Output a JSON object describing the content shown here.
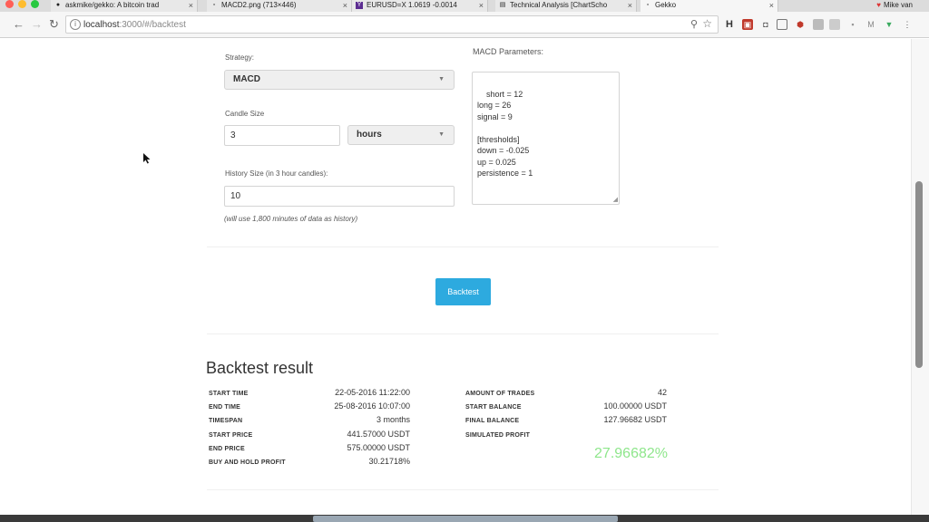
{
  "browser": {
    "tabs": [
      {
        "title": "askmike/gekko: A bitcoin trad",
        "favicon": "github-icon"
      },
      {
        "title": "MACD2.png (713×446)",
        "favicon": "page-icon"
      },
      {
        "title": "EURUSD=X 1.0619 -0.0014",
        "favicon": "yahoo-icon"
      },
      {
        "title": "Technical Analysis [ChartScho",
        "favicon": "chart-icon"
      },
      {
        "title": "Gekko",
        "favicon": "page-icon"
      }
    ],
    "profile_name": "Mike van",
    "url_host": "localhost",
    "url_path": ":3000/#/backtest"
  },
  "form": {
    "strategy_label": "Strategy:",
    "strategy_value": "MACD",
    "candle_size_label": "Candle Size",
    "candle_size_value": "3",
    "candle_unit_value": "hours",
    "history_label": "History Size (in 3 hour candles):",
    "history_value": "10",
    "history_hint": "(will use 1,800 minutes of data as history)",
    "params_label": "MACD Parameters:",
    "params_text": "short = 12\nlong = 26\nsignal = 9\n\n[thresholds]\ndown = -0.025\nup = 0.025\npersistence = 1"
  },
  "backtest_button": "Backtest",
  "result": {
    "title": "Backtest result",
    "left": [
      {
        "key": "START TIME",
        "value": "22-05-2016 11:22:00"
      },
      {
        "key": "END TIME",
        "value": "25-08-2016 10:07:00"
      },
      {
        "key": "TIMESPAN",
        "value": "3 months"
      },
      {
        "key": "START PRICE",
        "value": "441.57000 USDT"
      },
      {
        "key": "END PRICE",
        "value": "575.00000 USDT"
      },
      {
        "key": "BUY AND HOLD PROFIT",
        "value": "30.21718%"
      }
    ],
    "right": [
      {
        "key": "AMOUNT OF TRADES",
        "value": "42"
      },
      {
        "key": "START BALANCE",
        "value": "100.00000 USDT"
      },
      {
        "key": "FINAL BALANCE",
        "value": "127.96682 USDT"
      },
      {
        "key": "SIMULATED PROFIT",
        "value": ""
      }
    ],
    "simulated_profit": "27.96682%"
  },
  "colors": {
    "accent": "#2daadf",
    "profit": "#8ee68b"
  }
}
